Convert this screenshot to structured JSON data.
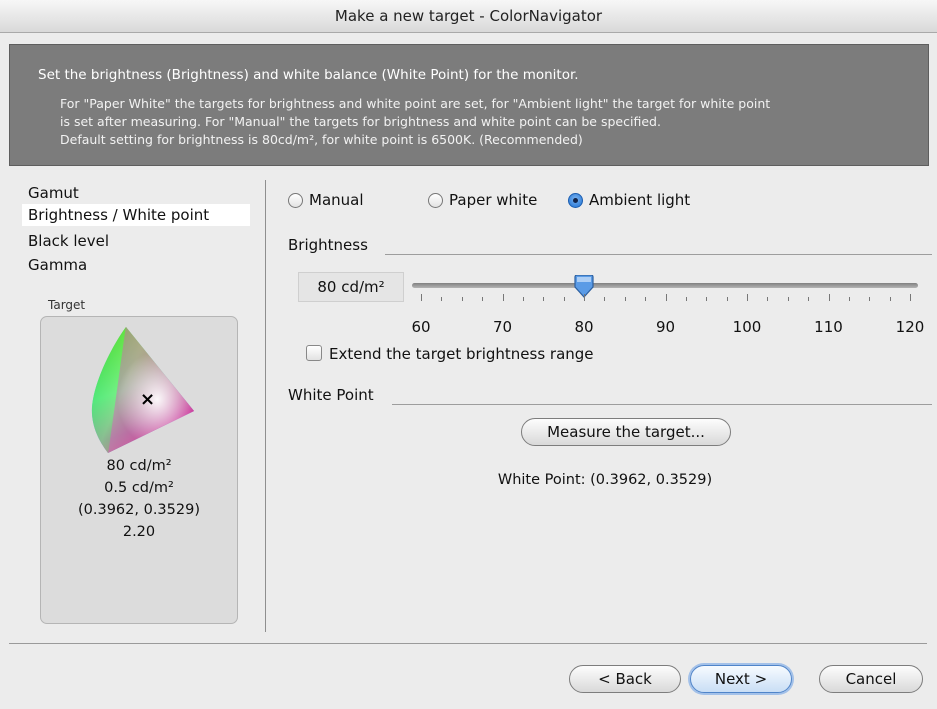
{
  "window": {
    "title": "Make a new target - ColorNavigator"
  },
  "banner": {
    "headline": "Set the brightness (Brightness) and white balance (White Point) for the monitor.",
    "line1": "For \"Paper White\" the targets for brightness and white point are set, for \"Ambient light\" the target for white point",
    "line2": "is set after measuring. For \"Manual\" the targets for brightness and white point can be specified.",
    "line3": "Default setting for brightness is 80cd/m², for white point is 6500K. (Recommended)"
  },
  "sidebar": {
    "items": [
      {
        "label": "Gamut",
        "selected": false
      },
      {
        "label": "Brightness / White point",
        "selected": true
      },
      {
        "label": "Black level",
        "selected": false
      },
      {
        "label": "Gamma",
        "selected": false
      }
    ],
    "target_label": "Target",
    "target": {
      "brightness": "80 cd/m²",
      "black_level": "0.5 cd/m²",
      "white_point": "(0.3962, 0.3529)",
      "gamma": "2.20",
      "marker": "×"
    }
  },
  "mode": {
    "options": [
      {
        "label": "Manual",
        "selected": false
      },
      {
        "label": "Paper white",
        "selected": false
      },
      {
        "label": "Ambient light",
        "selected": true
      }
    ]
  },
  "brightness": {
    "section_label": "Brightness",
    "value": "80 cd/m²",
    "slider_value": 80,
    "slider_min": 60,
    "slider_max": 120,
    "ticks": [
      "60",
      "70",
      "80",
      "90",
      "100",
      "110",
      "120"
    ],
    "extend_label": "Extend the target brightness range",
    "extend_checked": false
  },
  "white_point": {
    "section_label": "White Point",
    "measure_button": "Measure the target...",
    "readout": "White Point: (0.3962, 0.3529)"
  },
  "footer": {
    "back": "< Back",
    "next": "Next >",
    "cancel": "Cancel"
  },
  "colors": {
    "banner_bg": "#7c7c7c",
    "selected_radio": "#1d6fd1",
    "default_button": "#4f84c9"
  }
}
